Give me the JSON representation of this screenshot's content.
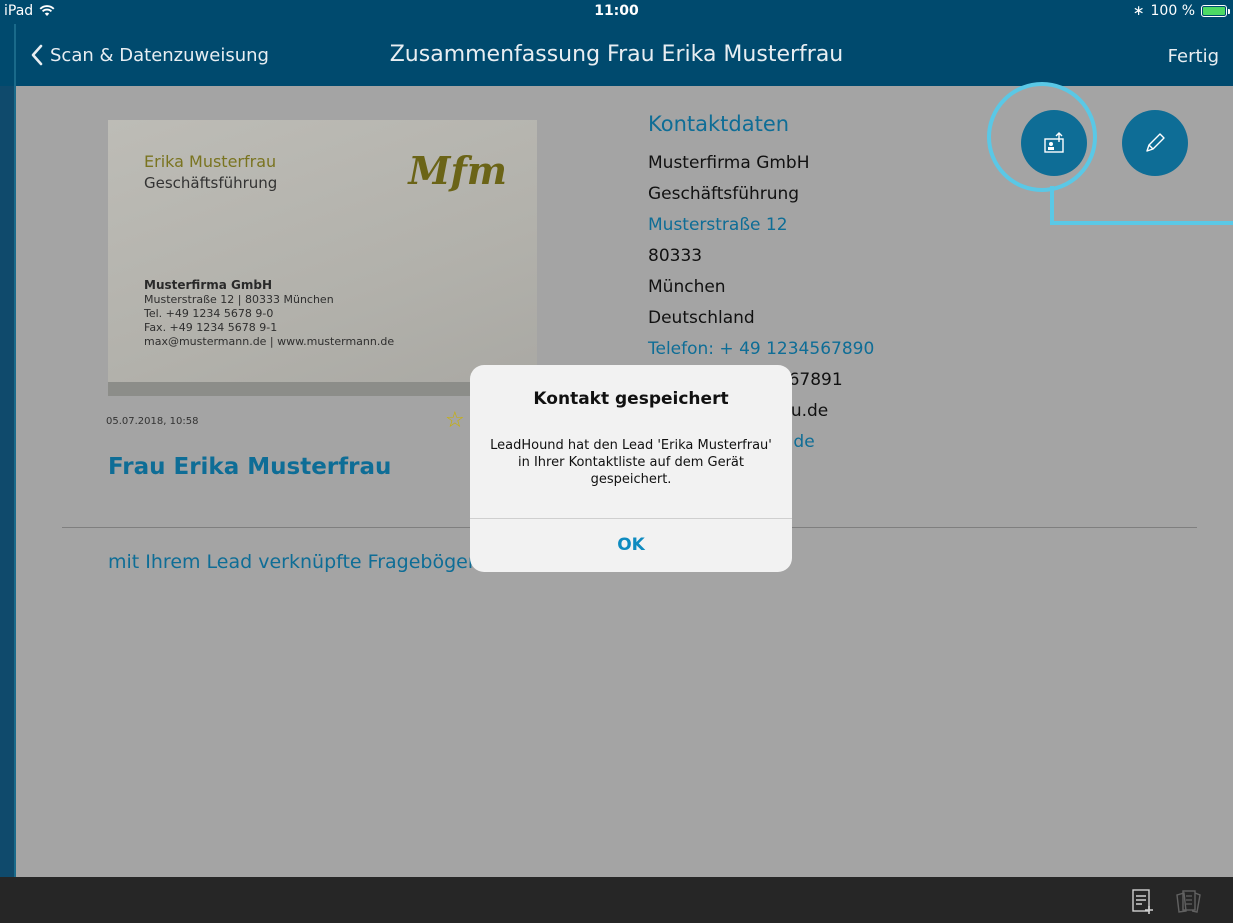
{
  "status_bar": {
    "device": "iPad",
    "time": "11:00",
    "battery_text": "100 %",
    "battery_level": 1.0
  },
  "nav": {
    "back_label": "Scan & Datenzuweisung",
    "title": "Zusammenfassung Frau Erika Musterfrau",
    "done_label": "Fertig"
  },
  "business_card": {
    "name": "Erika Musterfrau",
    "role": "Geschäftsführung",
    "logo": "Mfm",
    "company": "Musterfirma GmbH",
    "lines": [
      "Musterstraße 12 | 80333 München",
      "Tel. +49 1234 5678 9-0",
      "Fax. +49 1234 5678 9-1",
      "max@mustermann.de | www.mustermann.de"
    ]
  },
  "lead": {
    "date": "05.07.2018, 10:58",
    "name": "Frau Erika Musterfrau",
    "questionnaires_link": "mit Ihrem Lead verknüpfte Fragebögen"
  },
  "contact": {
    "heading": "Kontaktdaten",
    "company": "Musterfirma GmbH",
    "role": "Geschäftsführung",
    "street": "Musterstraße 12",
    "zip": "80333",
    "city": "München",
    "country": "Deutschland",
    "phone": "Telefon: + 49 1234567890",
    "fax": "Fax: + 49 1234567891",
    "email": "erika@musterfrau.de",
    "web": "www.musterfrau.de"
  },
  "alert": {
    "title": "Kontakt gespeichert",
    "message": "LeadHound hat den Lead 'Erika Musterfrau' in Ihrer Kontaktliste auf dem Gerät gespeichert.",
    "ok_label": "OK"
  },
  "icons": {
    "share": "share-contact-icon",
    "edit": "pencil-icon",
    "questionnaire": "questionnaire-add-icon",
    "cards": "cards-icon"
  },
  "colors": {
    "bar": "#004a6e",
    "accent": "#0e6d96",
    "highlight": "#5ac8e6",
    "battery": "#4cd964"
  }
}
